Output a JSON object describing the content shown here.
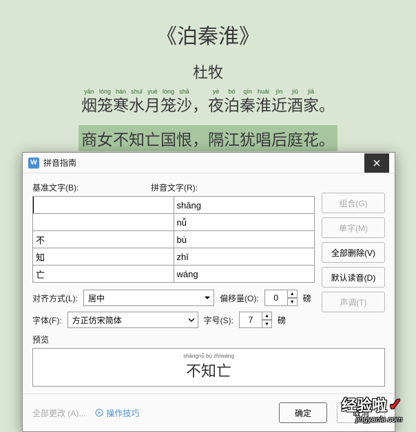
{
  "poem": {
    "title": "《泊秦淮》",
    "author": "杜牧",
    "line1": [
      {
        "py": "yān",
        "hz": "烟"
      },
      {
        "py": "lóng",
        "hz": "笼"
      },
      {
        "py": "hán",
        "hz": "寒"
      },
      {
        "py": "shuǐ",
        "hz": "水"
      },
      {
        "py": "yuè",
        "hz": "月"
      },
      {
        "py": "lóng",
        "hz": "笼"
      },
      {
        "py": "shā",
        "hz": "沙"
      },
      {
        "py": "",
        "hz": "，"
      },
      {
        "py": "yè",
        "hz": "夜"
      },
      {
        "py": "bó",
        "hz": "泊"
      },
      {
        "py": "qín",
        "hz": "秦"
      },
      {
        "py": "huái",
        "hz": "淮"
      },
      {
        "py": "jìn",
        "hz": "近"
      },
      {
        "py": "jiǔ",
        "hz": "酒"
      },
      {
        "py": "jiā",
        "hz": "家"
      },
      {
        "py": "",
        "hz": "。"
      }
    ],
    "line2": "商女不知亡国恨，隔江犹唱后庭花。"
  },
  "dialog": {
    "title": "拼音指南",
    "labels": {
      "base": "基准文字(B):",
      "pinyin": "拼音文字(R):",
      "align": "对齐方式(L):",
      "offset": "偏移量(O):",
      "font": "字体(F):",
      "size": "字号(S):",
      "preview": "预览",
      "unit": "磅"
    },
    "table": [
      {
        "base": "",
        "pinyin": "shāng"
      },
      {
        "base": "",
        "pinyin": "nǚ"
      },
      {
        "base": "不",
        "pinyin": "bù"
      },
      {
        "base": "知",
        "pinyin": "zhī"
      },
      {
        "base": "亡",
        "pinyin": "wáng"
      }
    ],
    "align_value": "居中",
    "offset_value": "0",
    "font_value": "方正仿宋简体",
    "size_value": "7",
    "buttons": {
      "combine": "组合(G)",
      "single": "单字(M)",
      "delete_all": "全部删除(V)",
      "default_read": "默认读音(D)",
      "tone": "声调(T)",
      "all_change": "全部更改 (A)...",
      "tips": "操作技巧",
      "ok": "确定",
      "cancel": "取消"
    },
    "preview": {
      "pinyin": "shāngnǚ bù zhīwáng",
      "hanzi": "不知亡"
    }
  },
  "watermark": {
    "text": "经验啦",
    "url": "jingyanla.com"
  }
}
